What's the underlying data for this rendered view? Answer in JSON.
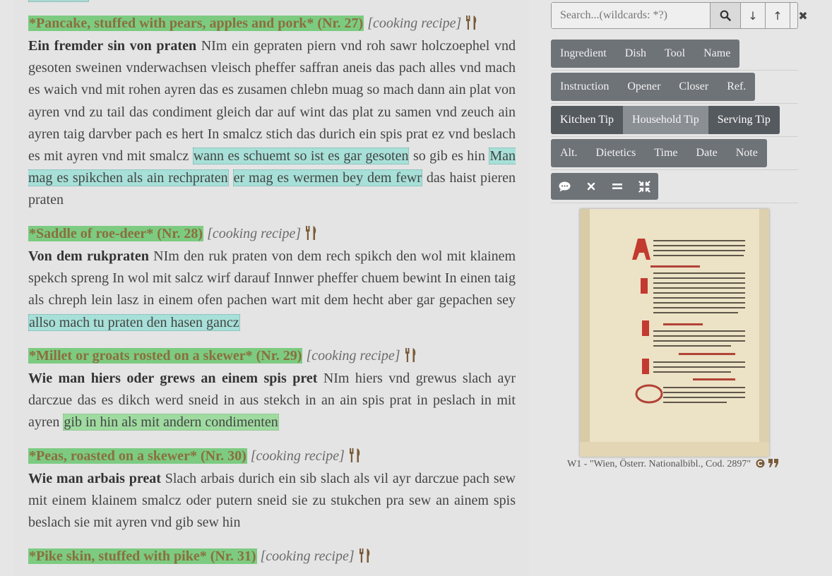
{
  "recipes": [
    {
      "title": "*Pancake, stuffed with pears, apples and pork* (Nr. 27)",
      "type": "[cooking recipe]",
      "head": "Ein fremder sin von praten",
      "text1": " NIm ein gepraten piern vnd roh sawr holczoephel vnd gesoten sweinen vnderwachsen vleisch pheffer saffran aneis das pach alles vnd mach es waich vnd mit rohen ayren das es zusamen chlebn muag so mach dann ain plat von ayren vnd zu tail das condiment gleich dar auf wint das plat zu samen vnd zeuch ain ayren taig darvber pach es hert In smalcz stich das durich ein spis prat ez vnd beslach es mit ayren vnd mit smalcz ",
      "tip1": "wann es schuemt so ist es gar gesoten",
      "text2": " so gib es hin ",
      "tip2": "Man mag es spikchen als ain rechpraten",
      "text3": " ",
      "tip3": "er mag es wermen bey dem fewr",
      "text4": " das haist pieren praten"
    },
    {
      "title": "*Saddle of roe-deer* (Nr. 28)",
      "type": "[cooking recipe]",
      "head": "Von dem rukpraten",
      "text1": " NIm den ruk praten von dem rech spikch den wol mit klainem spekch spreng In wol mit salcz wirf darauf Innwer pheffer chuem bewint In einen taig als chreph lein lasz in einem ofen pachen wart mit dem hecht aber gar gepachen sey ",
      "tip1": "allso mach tu praten den hasen gancz"
    },
    {
      "title": "*Millet or groats rosted on a skewer* (Nr. 29)",
      "type": "[cooking recipe]",
      "head": "Wie man hiers oder grews an einem spis pret",
      "text1": " NIm hiers vnd grewus slach ayr darczue das es dikch werd sneid in aus stekch in an ain spis prat in peslach in mit ayren ",
      "note1": "gib in hin als mit andern condimenten"
    },
    {
      "title": "*Peas, roasted on a skewer* (Nr. 30)",
      "type": "[cooking recipe]",
      "head": "Wie man arbais preat",
      "text1": " Slach arbais durich ein sib slach als vil ayr darczue pach sew mit einem klainem smalcz oder putern sneid sie zu stukchen pra sew an ainem spis beslach sie mit ayren vnd gib sew hin"
    },
    {
      "title": "*Pike skin, stuffed with pike* (Nr. 31)",
      "type": "[cooking recipe]"
    }
  ],
  "search": {
    "placeholder": "Search...(wildcards: *?)",
    "down": "↓",
    "up": "↑",
    "clear": "✖"
  },
  "filters": {
    "row1": [
      "Ingredient",
      "Dish",
      "Tool",
      "Name"
    ],
    "row2": [
      "Instruction",
      "Opener",
      "Closer",
      "Ref."
    ],
    "row3": [
      "Kitchen Tip",
      "Household Tip",
      "Serving Tip"
    ],
    "row4": [
      "Alt.",
      "Dietetics",
      "Time",
      "Date",
      "Note"
    ]
  },
  "icons": [
    "comment-icon",
    "close-x-icon",
    "equals-icon",
    "compress-icon"
  ],
  "caption": "W1 - \"Wien, Österr. Nationalbibl., Cod. 2897\"",
  "colors": {
    "title_highlight": "#7ccb81",
    "tip_highlight": "#a7e0d8",
    "button_group": "#6e7378",
    "active_button": "#8a8f94"
  }
}
